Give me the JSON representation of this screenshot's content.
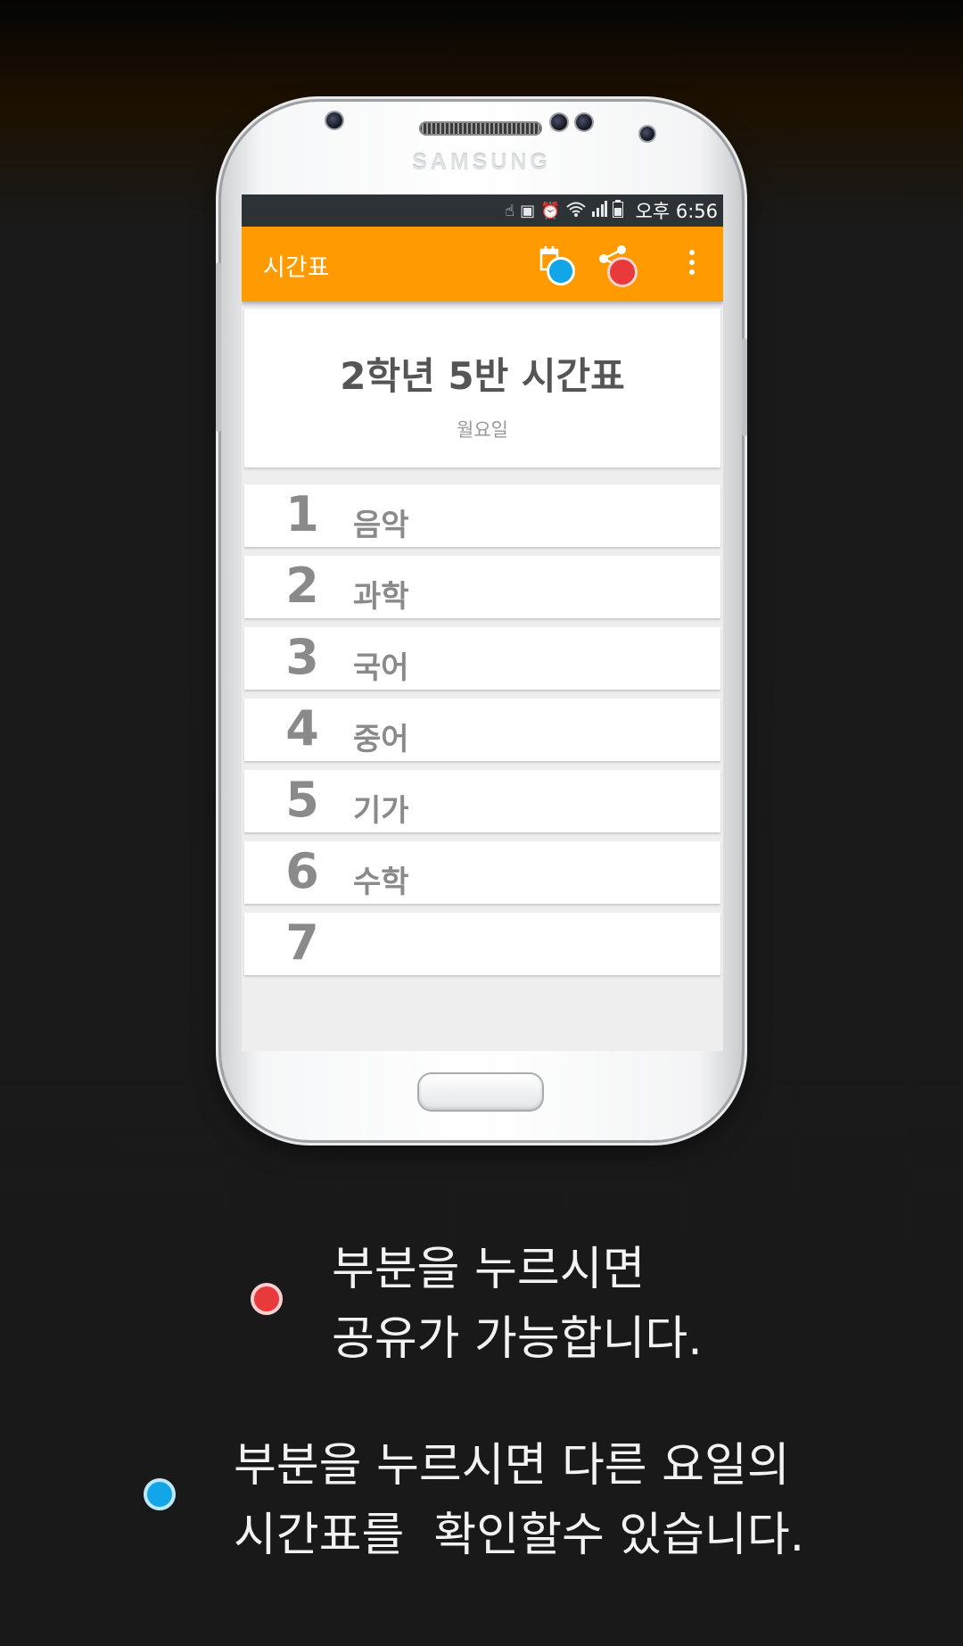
{
  "device": {
    "brand": "SAMSUNG"
  },
  "statusbar": {
    "time": "오후 6:56"
  },
  "appbar": {
    "title": "시간표"
  },
  "timetable": {
    "title": "2학년 5반 시간표",
    "day": "월요일",
    "periods": [
      {
        "number": "1",
        "subject": "음악"
      },
      {
        "number": "2",
        "subject": "과학"
      },
      {
        "number": "3",
        "subject": "국어"
      },
      {
        "number": "4",
        "subject": "중어"
      },
      {
        "number": "5",
        "subject": "기가"
      },
      {
        "number": "6",
        "subject": "수학"
      },
      {
        "number": "7",
        "subject": ""
      }
    ]
  },
  "captions": {
    "share_line1": "부분을 누르시면",
    "share_line2": "공유가 가능합니다.",
    "day_line1": "부분을 누르시면 다른 요일의",
    "day_line2": "시간표를  확인할수 있습니다."
  },
  "colors": {
    "accent": "#ff9a00",
    "red_dot": "#e8393b",
    "blue_dot": "#12a6e8"
  },
  "icons": {
    "calendar": "calendar-icon",
    "share": "share-icon",
    "overflow": "more-vert-icon"
  }
}
